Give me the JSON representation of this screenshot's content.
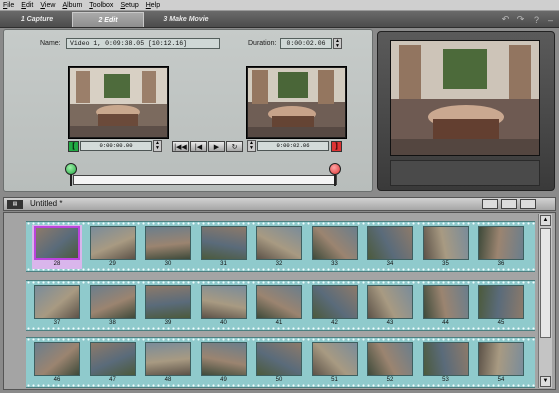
{
  "menu": [
    "File",
    "Edit",
    "View",
    "Album",
    "Toolbox",
    "Setup",
    "Help"
  ],
  "tabs": [
    {
      "label": "1 Capture"
    },
    {
      "label": "2 Edit"
    },
    {
      "label": "3 Make Movie"
    }
  ],
  "editor": {
    "name_label": "Name:",
    "name_value": "Video 1, 0:09:38.05  [10:12.16]",
    "duration_label": "Duration:",
    "duration_value": "0:00:02.06",
    "in_timecode": "0:00:00.00",
    "out_timecode": "0:00:02.06",
    "mark_in": "[",
    "mark_out": "]"
  },
  "album": {
    "title": "Untitled *",
    "rows": [
      [
        "28",
        "29",
        "30",
        "31",
        "32",
        "33",
        "34",
        "35",
        "36"
      ],
      [
        "37",
        "38",
        "39",
        "40",
        "41",
        "42",
        "43",
        "44",
        "45"
      ],
      [
        "46",
        "47",
        "48",
        "49",
        "50",
        "51",
        "52",
        "53",
        "54"
      ]
    ],
    "selected_clip": "28"
  },
  "colors": {
    "filmstrip": "#8fcacc",
    "selection": "#bb44dd",
    "mark_in": "#22aa44",
    "mark_out": "#dd3333"
  }
}
